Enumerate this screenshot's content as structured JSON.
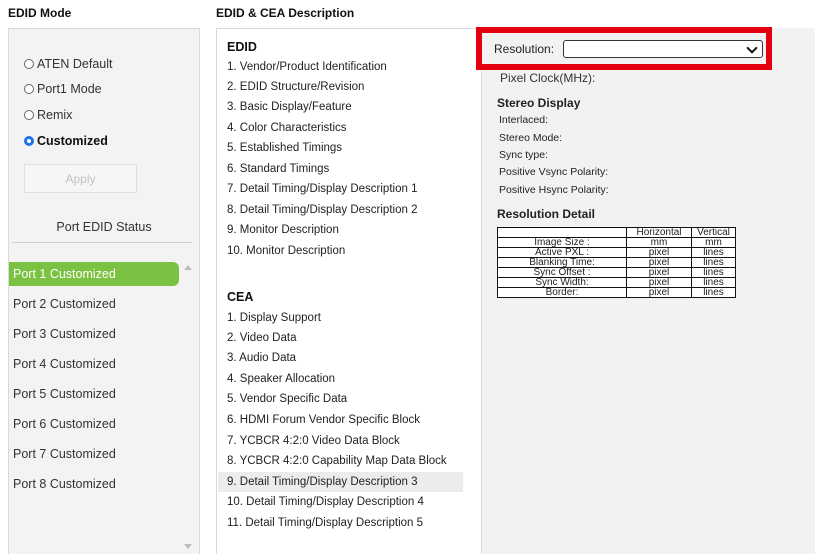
{
  "headers": {
    "edid_mode": "EDID Mode",
    "edid_cea": "EDID & CEA Description"
  },
  "modes": [
    {
      "label": "ATEN Default",
      "selected": false
    },
    {
      "label": "Port1 Mode",
      "selected": false
    },
    {
      "label": "Remix",
      "selected": false
    },
    {
      "label": "Customized",
      "selected": true
    }
  ],
  "apply_label": "Apply",
  "port_status_title": "Port EDID Status",
  "ports": [
    "Port 1  Customized",
    "Port 2  Customized",
    "Port 3  Customized",
    "Port 4  Customized",
    "Port 5  Customized",
    "Port 6  Customized",
    "Port 7  Customized",
    "Port 8  Customized"
  ],
  "edid": {
    "title": "EDID",
    "items": [
      "1.  Vendor/Product Identification",
      "2.  EDID Structure/Revision",
      "3.  Basic Display/Feature",
      "4.  Color Characteristics",
      "5.  Established Timings",
      "6.  Standard Timings",
      "7.  Detail Timing/Display Description 1",
      "8.  Detail Timing/Display Description 2",
      "9.  Monitor Description",
      "10.  Monitor Description"
    ]
  },
  "cea": {
    "title": "CEA",
    "items": [
      "1.  Display Support",
      "2.  Video Data",
      "3.  Audio Data",
      "4.  Speaker Allocation",
      "5.  Vendor Specific Data",
      "6.  HDMI Forum Vendor Specific Block",
      "7.  YCBCR 4:2:0 Video Data Block",
      "8.  YCBCR 4:2:0 Capability Map Data Block",
      "9.  Detail Timing/Display Description 3",
      "10.  Detail Timing/Display Description 4",
      "11.  Detail Timing/Display Description 5"
    ]
  },
  "right": {
    "resolution_label": "Resolution:",
    "resolution_value": "",
    "pixel_clock": "Pixel Clock(MHz):",
    "stereo_title": "Stereo Display",
    "stereo_fields": [
      "Interlaced:",
      "Stereo Mode:",
      "Sync type:",
      "Positive Vsync Polarity:",
      "Positive Hsync Polarity:"
    ],
    "res_detail_title": "Resolution Detail",
    "table": {
      "headers": [
        "",
        "Horizontal",
        "Vertical"
      ],
      "rows": [
        [
          "Image Size :",
          "mm",
          "mm"
        ],
        [
          "Active PXL :",
          "pixel",
          "lines"
        ],
        [
          "Blanking Time:",
          "pixel",
          "lines"
        ],
        [
          "Sync Offset :",
          "pixel",
          "lines"
        ],
        [
          "Sync Width:",
          "pixel",
          "lines"
        ],
        [
          "Border:",
          "pixel",
          "lines"
        ]
      ]
    }
  },
  "colors": {
    "selected_port": "#7cc242",
    "highlight_box": "#e3000f",
    "radio_on": "#1a73e8"
  }
}
